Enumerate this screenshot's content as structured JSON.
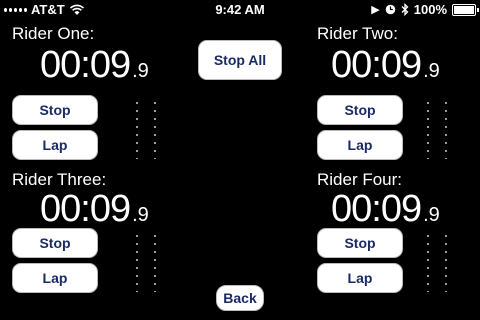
{
  "status_bar": {
    "carrier": "AT&T",
    "time": "9:42 AM",
    "battery": "100%",
    "battery_level": 1.0,
    "icons": [
      "signal-icon",
      "wifi-icon",
      "play-icon",
      "clock-icon",
      "bluetooth-icon",
      "battery-icon"
    ]
  },
  "stop_all_label": "Stop All",
  "back_label": "Back",
  "riders": [
    {
      "label": "Rider One:",
      "time_main": "00:09",
      "time_tenths": ".9",
      "stop_label": "Stop",
      "lap_label": "Lap"
    },
    {
      "label": "Rider Two:",
      "time_main": "00:09",
      "time_tenths": ".9",
      "stop_label": "Stop",
      "lap_label": "Lap"
    },
    {
      "label": "Rider Three:",
      "time_main": "00:09",
      "time_tenths": ".9",
      "stop_label": "Stop",
      "lap_label": "Lap"
    },
    {
      "label": "Rider Four:",
      "time_main": "00:09",
      "time_tenths": ".9",
      "stop_label": "Stop",
      "lap_label": "Lap"
    }
  ],
  "colors": {
    "background": "#000000",
    "button_bg": "#ffffff",
    "button_text": "#1a2a63"
  }
}
